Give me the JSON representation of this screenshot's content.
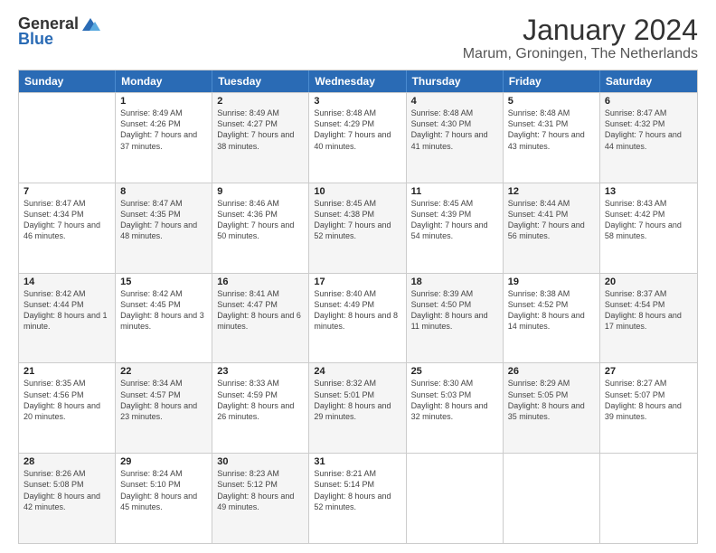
{
  "logo": {
    "general": "General",
    "blue": "Blue"
  },
  "title": {
    "month": "January 2024",
    "location": "Marum, Groningen, The Netherlands"
  },
  "headers": [
    "Sunday",
    "Monday",
    "Tuesday",
    "Wednesday",
    "Thursday",
    "Friday",
    "Saturday"
  ],
  "weeks": [
    [
      {
        "day": "",
        "sunrise": "",
        "sunset": "",
        "daylight": "",
        "shaded": false,
        "empty": true
      },
      {
        "day": "1",
        "sunrise": "Sunrise: 8:49 AM",
        "sunset": "Sunset: 4:26 PM",
        "daylight": "Daylight: 7 hours and 37 minutes.",
        "shaded": false
      },
      {
        "day": "2",
        "sunrise": "Sunrise: 8:49 AM",
        "sunset": "Sunset: 4:27 PM",
        "daylight": "Daylight: 7 hours and 38 minutes.",
        "shaded": true
      },
      {
        "day": "3",
        "sunrise": "Sunrise: 8:48 AM",
        "sunset": "Sunset: 4:29 PM",
        "daylight": "Daylight: 7 hours and 40 minutes.",
        "shaded": false
      },
      {
        "day": "4",
        "sunrise": "Sunrise: 8:48 AM",
        "sunset": "Sunset: 4:30 PM",
        "daylight": "Daylight: 7 hours and 41 minutes.",
        "shaded": true
      },
      {
        "day": "5",
        "sunrise": "Sunrise: 8:48 AM",
        "sunset": "Sunset: 4:31 PM",
        "daylight": "Daylight: 7 hours and 43 minutes.",
        "shaded": false
      },
      {
        "day": "6",
        "sunrise": "Sunrise: 8:47 AM",
        "sunset": "Sunset: 4:32 PM",
        "daylight": "Daylight: 7 hours and 44 minutes.",
        "shaded": true
      }
    ],
    [
      {
        "day": "7",
        "sunrise": "Sunrise: 8:47 AM",
        "sunset": "Sunset: 4:34 PM",
        "daylight": "Daylight: 7 hours and 46 minutes.",
        "shaded": false
      },
      {
        "day": "8",
        "sunrise": "Sunrise: 8:47 AM",
        "sunset": "Sunset: 4:35 PM",
        "daylight": "Daylight: 7 hours and 48 minutes.",
        "shaded": true
      },
      {
        "day": "9",
        "sunrise": "Sunrise: 8:46 AM",
        "sunset": "Sunset: 4:36 PM",
        "daylight": "Daylight: 7 hours and 50 minutes.",
        "shaded": false
      },
      {
        "day": "10",
        "sunrise": "Sunrise: 8:45 AM",
        "sunset": "Sunset: 4:38 PM",
        "daylight": "Daylight: 7 hours and 52 minutes.",
        "shaded": true
      },
      {
        "day": "11",
        "sunrise": "Sunrise: 8:45 AM",
        "sunset": "Sunset: 4:39 PM",
        "daylight": "Daylight: 7 hours and 54 minutes.",
        "shaded": false
      },
      {
        "day": "12",
        "sunrise": "Sunrise: 8:44 AM",
        "sunset": "Sunset: 4:41 PM",
        "daylight": "Daylight: 7 hours and 56 minutes.",
        "shaded": true
      },
      {
        "day": "13",
        "sunrise": "Sunrise: 8:43 AM",
        "sunset": "Sunset: 4:42 PM",
        "daylight": "Daylight: 7 hours and 58 minutes.",
        "shaded": false
      }
    ],
    [
      {
        "day": "14",
        "sunrise": "Sunrise: 8:42 AM",
        "sunset": "Sunset: 4:44 PM",
        "daylight": "Daylight: 8 hours and 1 minute.",
        "shaded": true
      },
      {
        "day": "15",
        "sunrise": "Sunrise: 8:42 AM",
        "sunset": "Sunset: 4:45 PM",
        "daylight": "Daylight: 8 hours and 3 minutes.",
        "shaded": false
      },
      {
        "day": "16",
        "sunrise": "Sunrise: 8:41 AM",
        "sunset": "Sunset: 4:47 PM",
        "daylight": "Daylight: 8 hours and 6 minutes.",
        "shaded": true
      },
      {
        "day": "17",
        "sunrise": "Sunrise: 8:40 AM",
        "sunset": "Sunset: 4:49 PM",
        "daylight": "Daylight: 8 hours and 8 minutes.",
        "shaded": false
      },
      {
        "day": "18",
        "sunrise": "Sunrise: 8:39 AM",
        "sunset": "Sunset: 4:50 PM",
        "daylight": "Daylight: 8 hours and 11 minutes.",
        "shaded": true
      },
      {
        "day": "19",
        "sunrise": "Sunrise: 8:38 AM",
        "sunset": "Sunset: 4:52 PM",
        "daylight": "Daylight: 8 hours and 14 minutes.",
        "shaded": false
      },
      {
        "day": "20",
        "sunrise": "Sunrise: 8:37 AM",
        "sunset": "Sunset: 4:54 PM",
        "daylight": "Daylight: 8 hours and 17 minutes.",
        "shaded": true
      }
    ],
    [
      {
        "day": "21",
        "sunrise": "Sunrise: 8:35 AM",
        "sunset": "Sunset: 4:56 PM",
        "daylight": "Daylight: 8 hours and 20 minutes.",
        "shaded": false
      },
      {
        "day": "22",
        "sunrise": "Sunrise: 8:34 AM",
        "sunset": "Sunset: 4:57 PM",
        "daylight": "Daylight: 8 hours and 23 minutes.",
        "shaded": true
      },
      {
        "day": "23",
        "sunrise": "Sunrise: 8:33 AM",
        "sunset": "Sunset: 4:59 PM",
        "daylight": "Daylight: 8 hours and 26 minutes.",
        "shaded": false
      },
      {
        "day": "24",
        "sunrise": "Sunrise: 8:32 AM",
        "sunset": "Sunset: 5:01 PM",
        "daylight": "Daylight: 8 hours and 29 minutes.",
        "shaded": true
      },
      {
        "day": "25",
        "sunrise": "Sunrise: 8:30 AM",
        "sunset": "Sunset: 5:03 PM",
        "daylight": "Daylight: 8 hours and 32 minutes.",
        "shaded": false
      },
      {
        "day": "26",
        "sunrise": "Sunrise: 8:29 AM",
        "sunset": "Sunset: 5:05 PM",
        "daylight": "Daylight: 8 hours and 35 minutes.",
        "shaded": true
      },
      {
        "day": "27",
        "sunrise": "Sunrise: 8:27 AM",
        "sunset": "Sunset: 5:07 PM",
        "daylight": "Daylight: 8 hours and 39 minutes.",
        "shaded": false
      }
    ],
    [
      {
        "day": "28",
        "sunrise": "Sunrise: 8:26 AM",
        "sunset": "Sunset: 5:08 PM",
        "daylight": "Daylight: 8 hours and 42 minutes.",
        "shaded": true
      },
      {
        "day": "29",
        "sunrise": "Sunrise: 8:24 AM",
        "sunset": "Sunset: 5:10 PM",
        "daylight": "Daylight: 8 hours and 45 minutes.",
        "shaded": false
      },
      {
        "day": "30",
        "sunrise": "Sunrise: 8:23 AM",
        "sunset": "Sunset: 5:12 PM",
        "daylight": "Daylight: 8 hours and 49 minutes.",
        "shaded": true
      },
      {
        "day": "31",
        "sunrise": "Sunrise: 8:21 AM",
        "sunset": "Sunset: 5:14 PM",
        "daylight": "Daylight: 8 hours and 52 minutes.",
        "shaded": false
      },
      {
        "day": "",
        "sunrise": "",
        "sunset": "",
        "daylight": "",
        "shaded": false,
        "empty": true
      },
      {
        "day": "",
        "sunrise": "",
        "sunset": "",
        "daylight": "",
        "shaded": false,
        "empty": true
      },
      {
        "day": "",
        "sunrise": "",
        "sunset": "",
        "daylight": "",
        "shaded": false,
        "empty": true
      }
    ]
  ]
}
